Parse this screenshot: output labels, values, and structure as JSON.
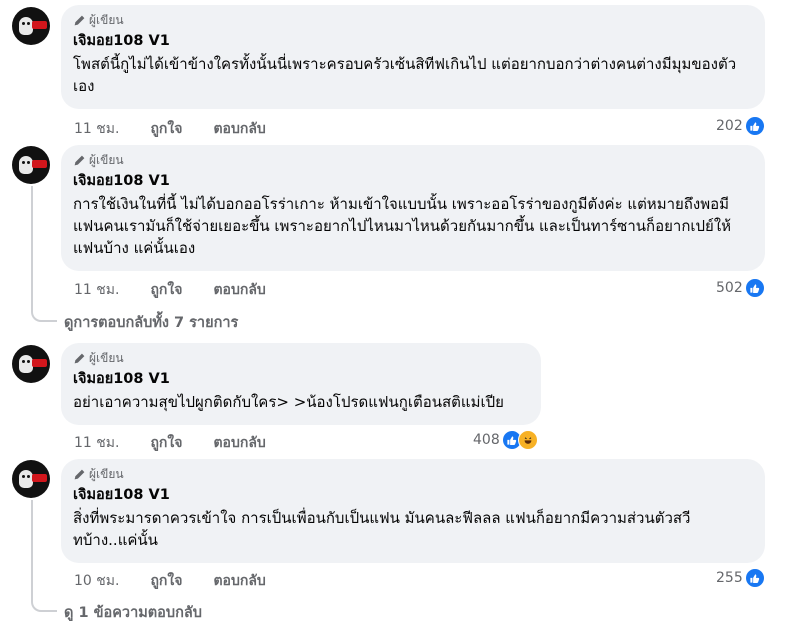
{
  "comments": [
    {
      "badge": "ผู้เขียน",
      "author": "เจิมอย108 V1",
      "text": "โพสต์นี้กูไม่ได้เข้าข้างใครทั้งนั้นนี่เพราะครอบครัวเซ้นสิทีฟเกินไป แต่อยากบอกว่าต่างคนต่างมีมุมของตัวเอง",
      "time": "11 ชม.",
      "like_label": "ถูกใจ",
      "reply_label": "ตอบกลับ",
      "reaction_count": "202",
      "reaction_icons": [
        "like-icon"
      ]
    },
    {
      "badge": "ผู้เขียน",
      "author": "เจิมอย108 V1",
      "text": "การใช้เงินในที่นี้ ไม่ได้บอกออโรร่าเกาะ ห้ามเข้าใจแบบนั้น เพราะออโรร่าของกูมีตังค่ะ แต่หมายถึงพอมีแฟนคนเรามันก็ใช้จ่ายเยอะขึ้น เพราะอยากไปไหนมาไหนด้วยกันมากขึ้น และเป็นทาร์ซานก็อยากเปย์ให้แฟนบ้าง แค่นั้นเอง",
      "time": "11 ชม.",
      "like_label": "ถูกใจ",
      "reply_label": "ตอบกลับ",
      "reaction_count": "502",
      "reaction_icons": [
        "like-icon"
      ],
      "view_replies": "ดูการตอบกลับทั้ง 7 รายการ"
    },
    {
      "badge": "ผู้เขียน",
      "author": "เจิมอย108 V1",
      "text": "อย่าเอาความสุขไปผูกติดกับใคร> >น้องโปรดแฟนกูเตือนสติแม่เปีย",
      "time": "11 ชม.",
      "like_label": "ถูกใจ",
      "reply_label": "ตอบกลับ",
      "reaction_count": "408",
      "reaction_icons": [
        "like-icon",
        "haha-icon"
      ]
    },
    {
      "badge": "ผู้เขียน",
      "author": "เจิมอย108 V1",
      "text": "สิ่งที่พระมารดาควรเข้าใจ การเป็นเพื่อนกับเป็นแฟน มันคนละฟีลลล แฟนก็อยากมีความส่วนตัวสวีทบ้าง..แค่นั้น",
      "time": "10 ชม.",
      "like_label": "ถูกใจ",
      "reply_label": "ตอบกลับ",
      "reaction_count": "255",
      "reaction_icons": [
        "like-icon"
      ],
      "view_replies": "ดู 1 ข้อความตอบกลับ"
    }
  ],
  "colors": {
    "bubble": "#f0f2f5",
    "like_blue": "#1877f2",
    "secondary_text": "#65676b",
    "thread_line": "#ced0d4"
  }
}
